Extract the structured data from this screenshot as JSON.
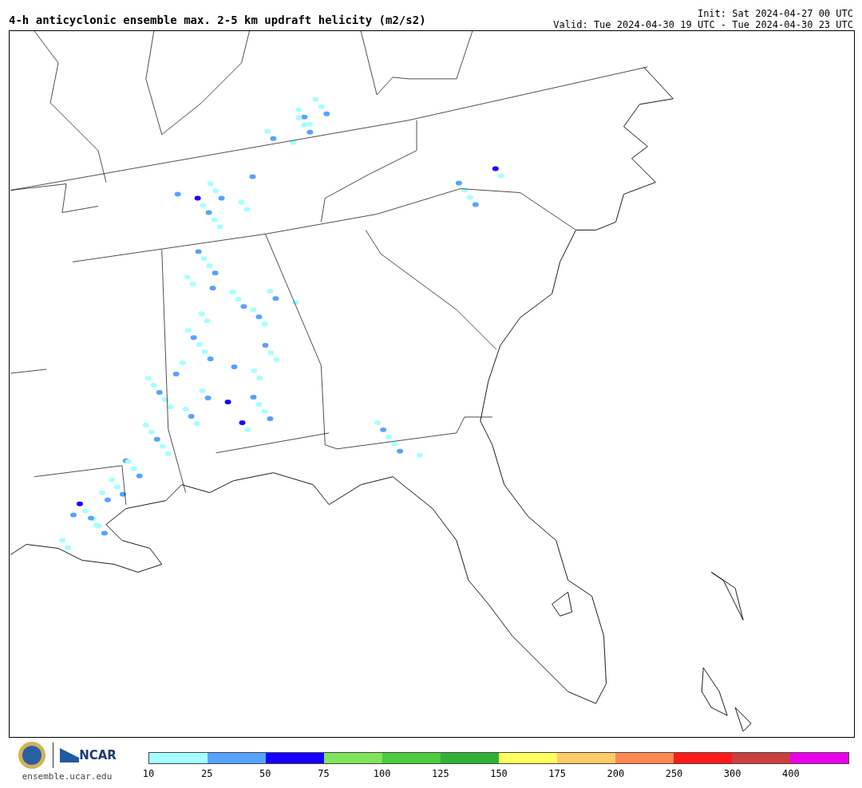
{
  "title": "4-h anticyclonic ensemble max. 2-5 km updraft helicity (m2/s2)",
  "init": "Init: Sat 2024-04-27 00 UTC",
  "valid": "Valid: Tue 2024-04-30 19 UTC - Tue 2024-04-30 23 UTC",
  "footer": {
    "logo_text": "NCAR",
    "url": "ensemble.ucar.edu"
  },
  "legend": {
    "segments": [
      {
        "color": "#a6ffff"
      },
      {
        "color": "#56a2ff"
      },
      {
        "color": "#1a00ff"
      },
      {
        "color": "#7fe55a"
      },
      {
        "color": "#4ccc3f"
      },
      {
        "color": "#30b236"
      },
      {
        "color": "#ffff5e"
      },
      {
        "color": "#ffcc66"
      },
      {
        "color": "#ff894f"
      },
      {
        "color": "#ff1a1a"
      },
      {
        "color": "#cc3f3f"
      },
      {
        "color": "#ea00ea"
      }
    ],
    "ticks": [
      "10",
      "25",
      "50",
      "75",
      "100",
      "125",
      "150",
      "175",
      "200",
      "250",
      "300",
      "400"
    ]
  }
}
